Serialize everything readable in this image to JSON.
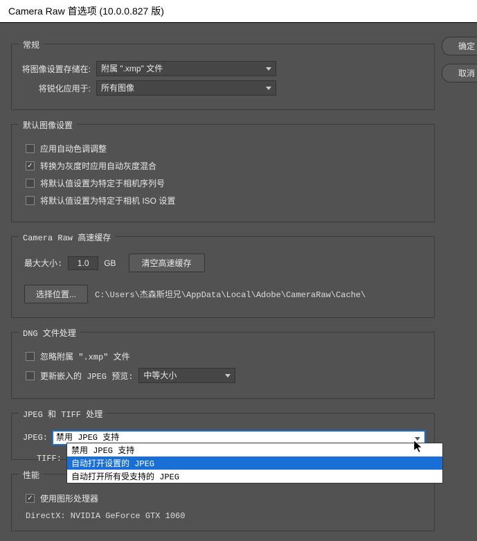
{
  "title": "Camera Raw 首选项  (10.0.0.827 版)",
  "buttons": {
    "ok": "确定",
    "cancel": "取消"
  },
  "general": {
    "legend": "常规",
    "save_settings_label": "将图像设置存储在:",
    "save_settings_value": "附属 \".xmp\" 文件",
    "sharpen_label": "将锐化应用于:",
    "sharpen_value": "所有图像"
  },
  "defaults": {
    "legend": "默认图像设置",
    "auto_tone": "应用自动色调调整",
    "auto_grayscale": "转换为灰度时应用自动灰度混合",
    "specific_serial": "将默认值设置为特定于相机序列号",
    "specific_iso": "将默认值设置为特定于相机 ISO 设置"
  },
  "cache": {
    "legend": "Camera Raw 高速缓存",
    "max_size_label": "最大大小:",
    "max_size_value": "1.0",
    "gb": "GB",
    "purge": "清空高速缓存",
    "select_loc": "选择位置...",
    "path": "C:\\Users\\杰森斯坦兄\\AppData\\Local\\Adobe\\CameraRaw\\Cache\\"
  },
  "dng": {
    "legend": "DNG 文件处理",
    "ignore_xmp": "忽略附属 \".xmp\" 文件",
    "update_jpeg_label": "更新嵌入的 JPEG 预览:",
    "update_jpeg_value": "中等大小"
  },
  "jpegtiff": {
    "legend": "JPEG 和 TIFF 处理",
    "jpeg_label": "JPEG:",
    "jpeg_value": "禁用 JPEG 支持",
    "tiff_label": "TIFF:",
    "options": [
      "禁用 JPEG 支持",
      "自动打开设置的 JPEG",
      "自动打开所有受支持的 JPEG"
    ]
  },
  "perf": {
    "legend": "性能",
    "use_gpu": "使用图形处理器",
    "directx": "DirectX: NVIDIA GeForce GTX 1060"
  }
}
